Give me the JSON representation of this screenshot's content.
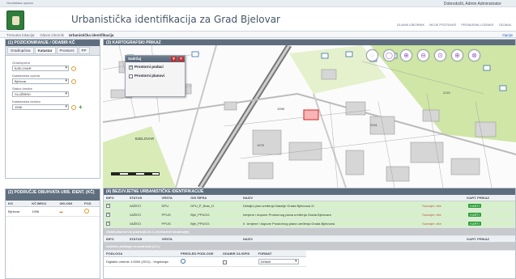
{
  "topbar": {
    "left_text": "Geodetska uprava",
    "user": "Dobrodošli, Admin Administrator"
  },
  "header": {
    "title": "Urbanistička identifikacija za Grad Bjelovar",
    "nav": [
      "GLAVNI IZBORNIK",
      "MOJE POSTAVKE",
      "PROMJENA LOZINKE",
      "ODJAVA"
    ]
  },
  "breadcrumb": {
    "items": [
      "Trenutna lokacija:",
      "Glavni izbornik",
      "Urbanistička identifikacija"
    ],
    "right": "Opcije"
  },
  "left_panel": {
    "title": "(1) POZICIONIRANJE / ODABIR KČ",
    "tabs": [
      "Grad/općina",
      "Katastar",
      "Prostorni",
      "PP"
    ],
    "fields": [
      {
        "label": "Grad/općina",
        "value": "BJELOVAR"
      },
      {
        "label": "Katastarska općina",
        "value": "Bjelovar"
      },
      {
        "label": "Status čestice",
        "value": "SLUŽBENI"
      },
      {
        "label": "Katastarska čestica",
        "value": "1998"
      }
    ]
  },
  "area_panel": {
    "title": "(2) PODRUČJE OBUHVATA URB. IDENT. (KČ)",
    "columns": [
      "KO",
      "KČ BROJ",
      "UKLONI",
      "POZ."
    ],
    "rows": [
      {
        "ko": "Bjelovar",
        "kc": "1998"
      }
    ]
  },
  "map_panel": {
    "title": "(3) KARTOGRAFSKI PRIKAZ",
    "tools": [
      "◌",
      "◯",
      "⊕",
      "⊖",
      "⊙",
      "⊕",
      "⊗",
      "⊙"
    ],
    "layers_title": "Sadržaj",
    "layers": [
      "Prostorni podaci",
      "Prostorni planovi"
    ],
    "place_label": "BJELOVAR",
    "scale_label": "0"
  },
  "ident_panel": {
    "title": "(4) BEZUVJETNE URBANISTIČKE IDENTIFIKACIJE",
    "columns": [
      "INFO",
      "STATUS",
      "VRSTA",
      "GIS ŠIFRA",
      "NAZIV",
      "",
      "KART. PRIKAZ"
    ],
    "rows": [
      {
        "status": "VAŽEĆI",
        "vrsta": "DPU",
        "gis": "DPU_P_Brac_D",
        "naziv": "Detaljni plan uređenja Naselje Grada Bjelovara 2r",
        "info": "Saznajte više"
      },
      {
        "status": "VAŽEĆI",
        "vrsta": "PPUG",
        "gis": "Bjel_PPUGG",
        "naziv": "Izmjene i dopune Prostornog plana uređenja Grada Bjelovara",
        "info": "Saznajte više"
      },
      {
        "status": "VAŽEĆI",
        "vrsta": "PPUG",
        "gis": "Bjel_PPUGG",
        "naziv": "II. Izmjene i dopune Prostornog plana uređenja Grada Bjelovara",
        "info": "Saznajte više"
      }
    ],
    "other_plans": "Ostali planovi na području (k.č.) (ne/važeći ekstenzije)",
    "other_columns": [
      "INFO",
      "STATUS",
      "VRSTA",
      "NAZIV",
      "",
      "KART. PRIKAZ"
    ],
    "sources": "Izvješće podloge na području (k.č.)",
    "sources_columns": [
      "PODLOGA",
      "PREGLED PODLOGE",
      "ODABIR ZA ISPIS",
      "FORMAT"
    ],
    "source_row": {
      "name": "Digitalni ortofoto 1:5000 (2011) - Vegetacija",
      "format": "Default"
    },
    "kart_label": "KARTI"
  },
  "colors": {
    "accent": "#2d9d3a",
    "header": "#5e6e7e",
    "highlight": "#d7f0cc"
  }
}
